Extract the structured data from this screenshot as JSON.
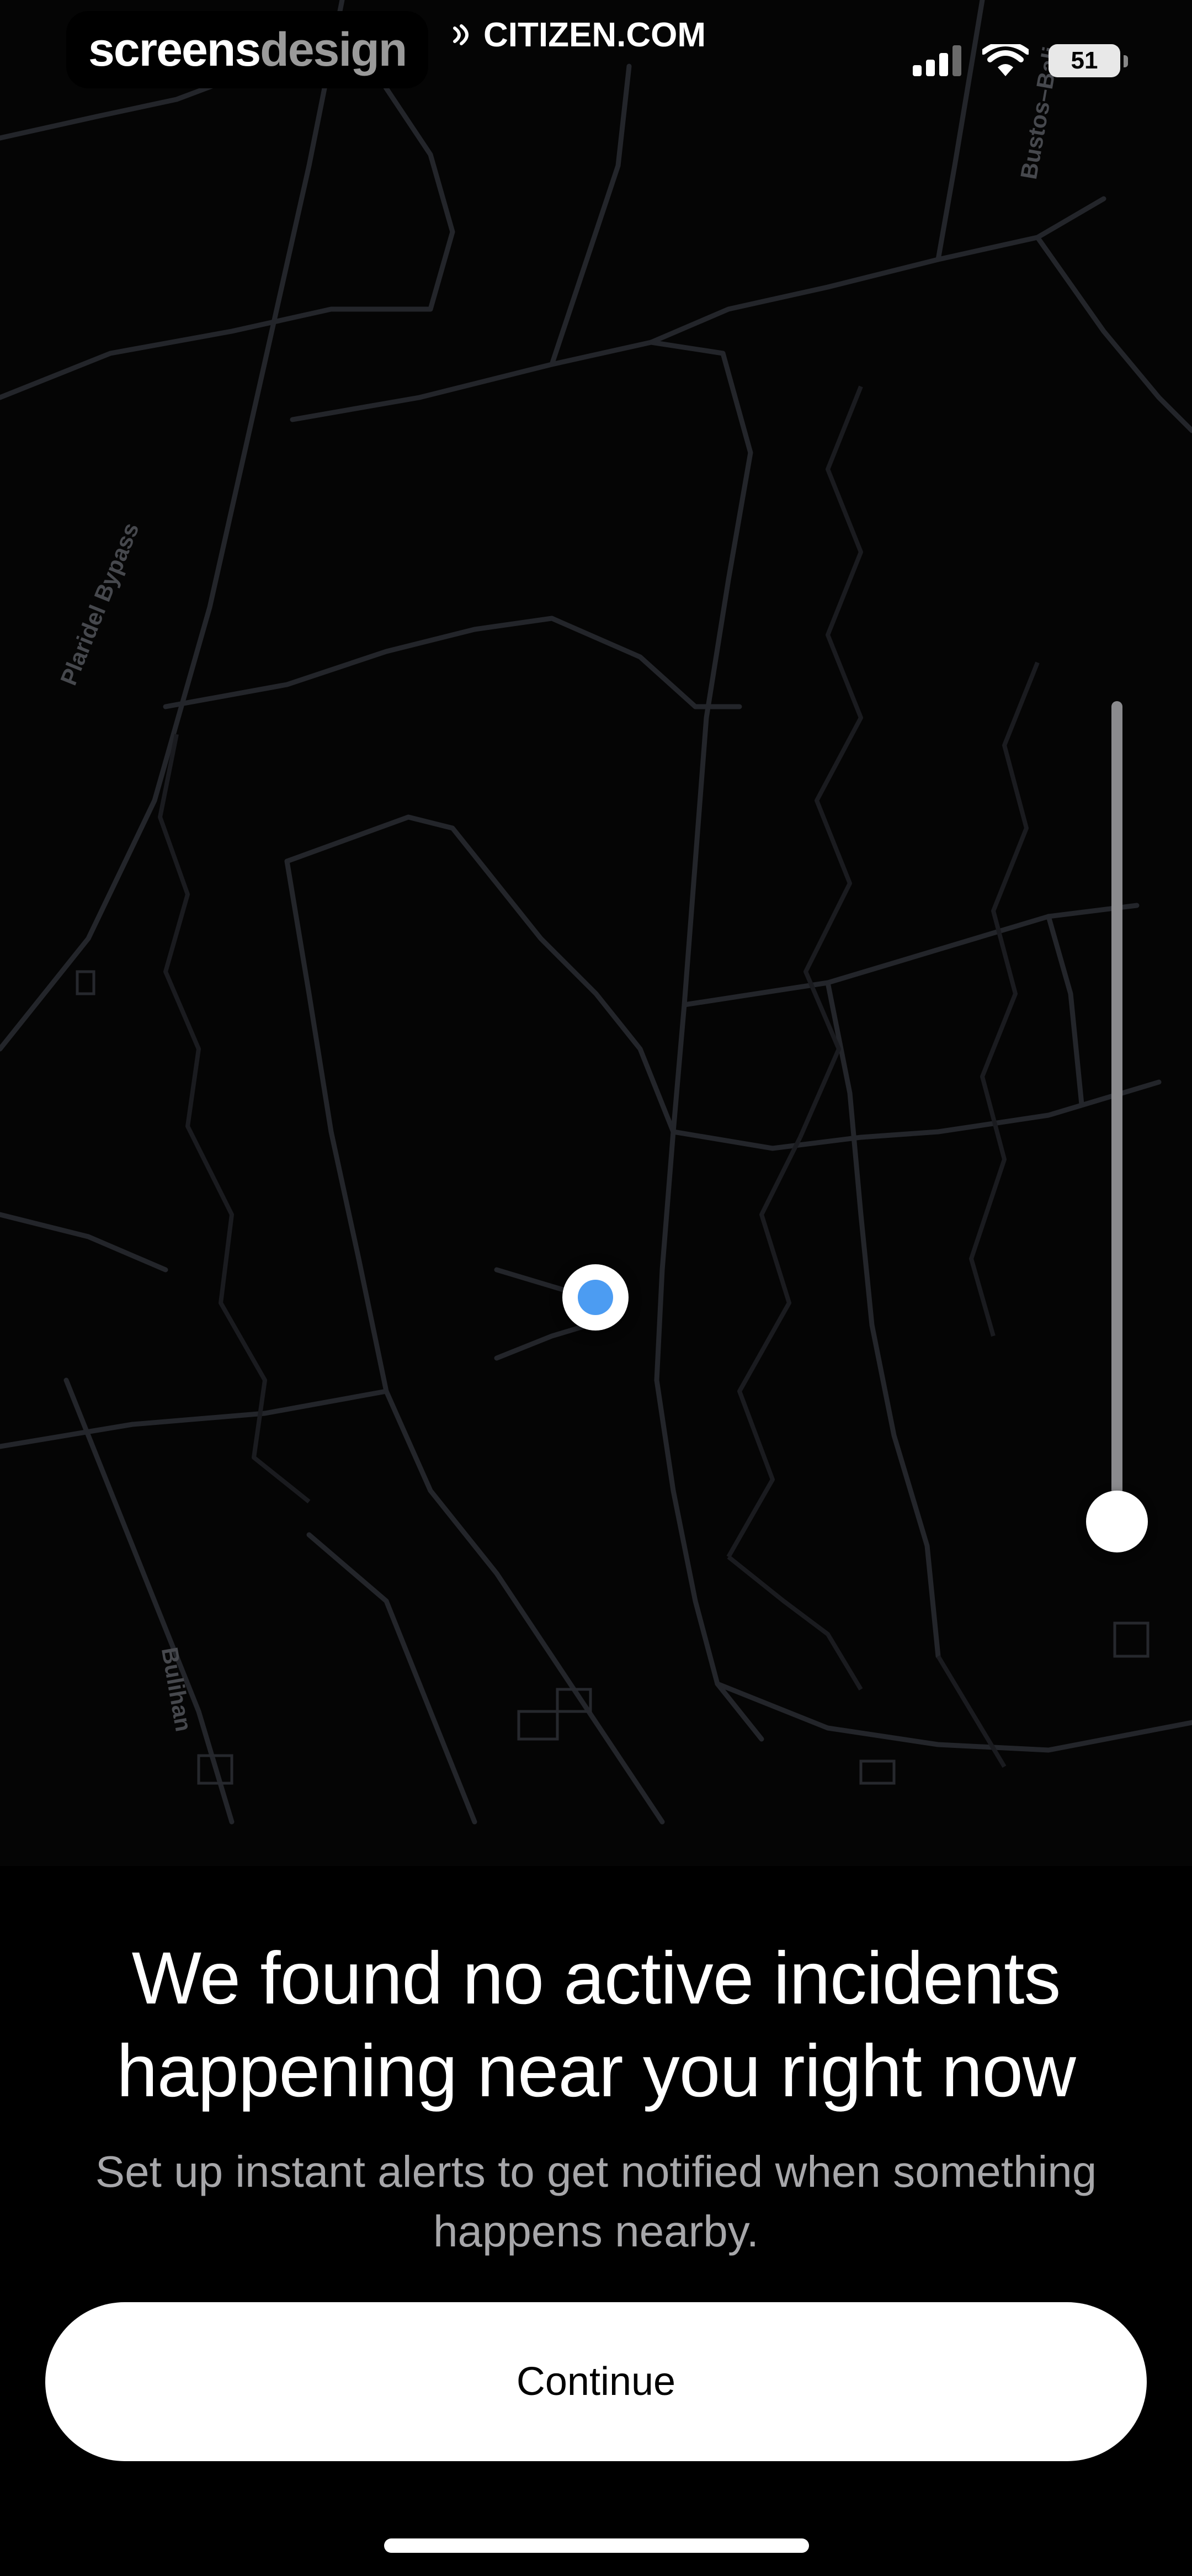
{
  "status_bar": {
    "watermark_primary": "screens",
    "watermark_secondary": "design",
    "site_label": "CITIZEN.COM",
    "battery_level": "51",
    "signal_icon": "cellular-signal-icon",
    "wifi_icon": "wifi-icon"
  },
  "map": {
    "road_labels": {
      "plaridel_bypass": "Plaridel Bypass",
      "bulihan": "Bulihan",
      "bustos": "Bustos–Bali"
    },
    "radius_slider_level": 0.0
  },
  "content": {
    "headline_line1": "We found no active incidents",
    "headline_line2": "happening near you right now",
    "subtext_line1": "Set up instant alerts to get notified when something",
    "subtext_line2": "happens nearby.",
    "continue_label": "Continue"
  },
  "colors": {
    "background": "#000000",
    "map_road": "#2a2c31",
    "location_blue": "#4c9cf2",
    "subtext_gray": "#a7a7aa",
    "slider_gray": "#8b8b8e"
  }
}
